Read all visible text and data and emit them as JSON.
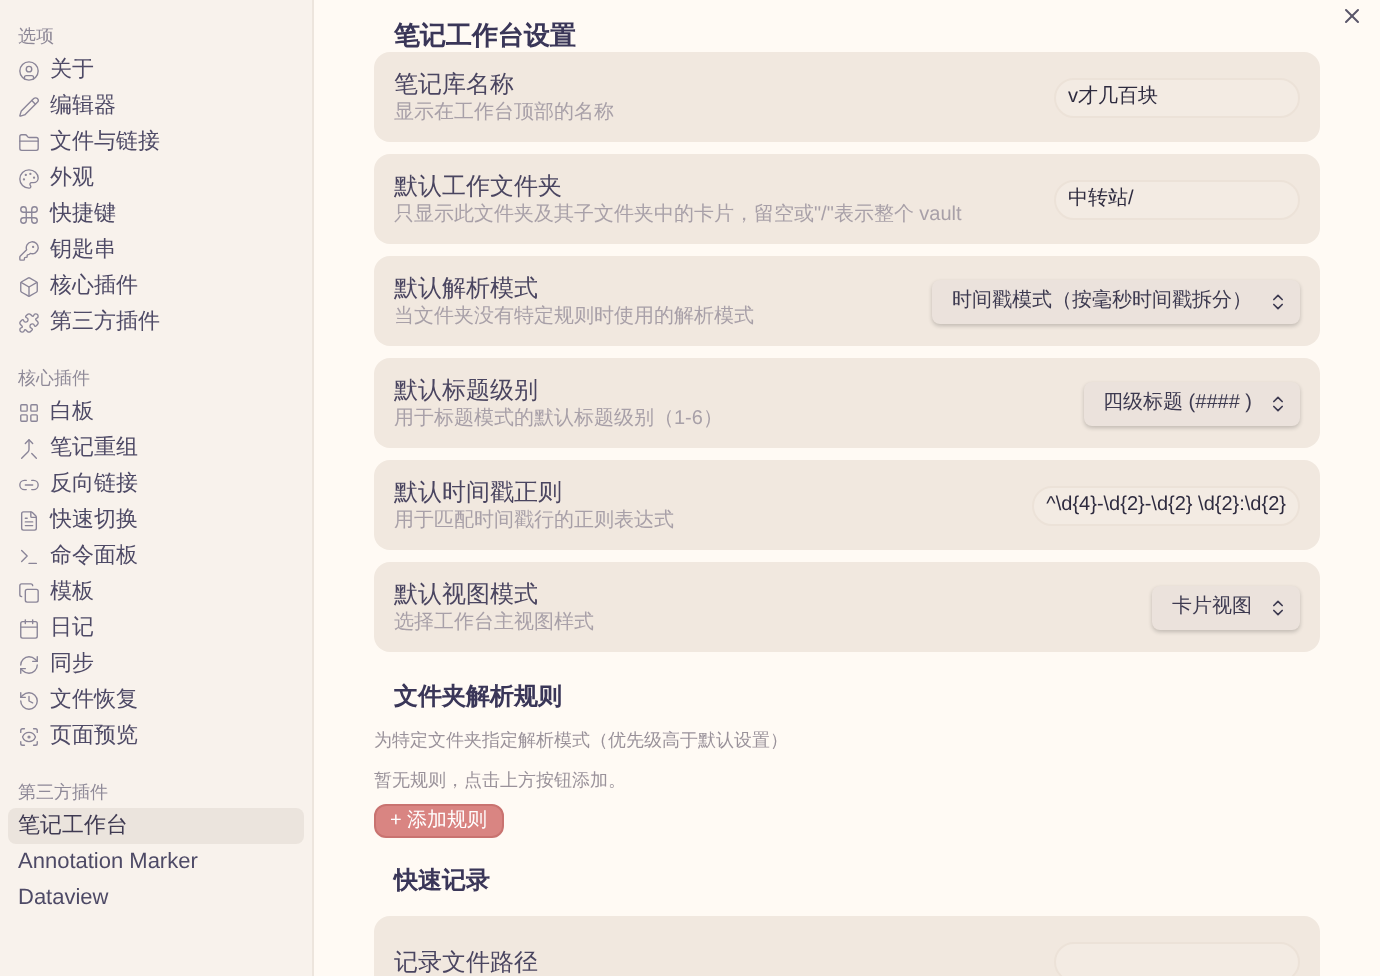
{
  "sidebar": {
    "groups": [
      {
        "label": "选项",
        "items": [
          {
            "label": "关于",
            "selected": false
          },
          {
            "label": "编辑器",
            "selected": false
          },
          {
            "label": "文件与链接",
            "selected": false
          },
          {
            "label": "外观",
            "selected": false
          },
          {
            "label": "快捷键",
            "selected": false
          },
          {
            "label": "钥匙串",
            "selected": false
          },
          {
            "label": "核心插件",
            "selected": false
          },
          {
            "label": "第三方插件",
            "selected": false
          }
        ]
      },
      {
        "label": "核心插件",
        "items": [
          {
            "label": "白板",
            "selected": false
          },
          {
            "label": "笔记重组",
            "selected": false
          },
          {
            "label": "反向链接",
            "selected": false
          },
          {
            "label": "快速切换",
            "selected": false
          },
          {
            "label": "命令面板",
            "selected": false
          },
          {
            "label": "模板",
            "selected": false
          },
          {
            "label": "日记",
            "selected": false
          },
          {
            "label": "同步",
            "selected": false
          },
          {
            "label": "文件恢复",
            "selected": false
          },
          {
            "label": "页面预览",
            "selected": false
          }
        ]
      },
      {
        "label": "第三方插件",
        "items": [
          {
            "label": "笔记工作台",
            "selected": true
          },
          {
            "label": "Annotation Marker",
            "selected": false
          },
          {
            "label": "Dataview",
            "selected": false
          }
        ]
      }
    ]
  },
  "title": "笔记工作台设置",
  "settings": [
    {
      "name": "笔记库名称",
      "description": "显示在工作台顶部的名称",
      "kind": "input",
      "value": "v才几百块"
    },
    {
      "name": "默认工作文件夹",
      "description": "只显示此文件夹及其子文件夹中的卡片，留空或\"/\"表示整个 vault",
      "kind": "input",
      "value": "中转站/"
    },
    {
      "name": "默认解析模式",
      "description": "当文件夹没有特定规则时使用的解析模式",
      "kind": "select",
      "value": "时间戳模式（按毫秒时间戳拆分）"
    },
    {
      "name": "默认标题级别",
      "description": "用于标题模式的默认标题级别（1-6）",
      "kind": "select",
      "value": "四级标题 (#### )"
    },
    {
      "name": "默认时间戳正则",
      "description": "用于匹配时间戳行的正则表达式",
      "kind": "input",
      "value": "^\\d{4}-\\d{2}-\\d{2} \\d{2}:\\d{2}"
    },
    {
      "name": "默认视图模式",
      "description": "选择工作台主视图样式",
      "kind": "select",
      "value": "卡片视图"
    }
  ],
  "rules_section": {
    "heading": "文件夹解析规则",
    "description": "为特定文件夹指定解析模式（优先级高于默认设置）",
    "empty_note": "暂无规则，点击上方按钮添加。",
    "add_button": "+ 添加规则"
  },
  "quick_section": {
    "heading": "快速记录",
    "settings": [
      {
        "name": "记录文件路径",
        "kind": "input"
      }
    ]
  }
}
